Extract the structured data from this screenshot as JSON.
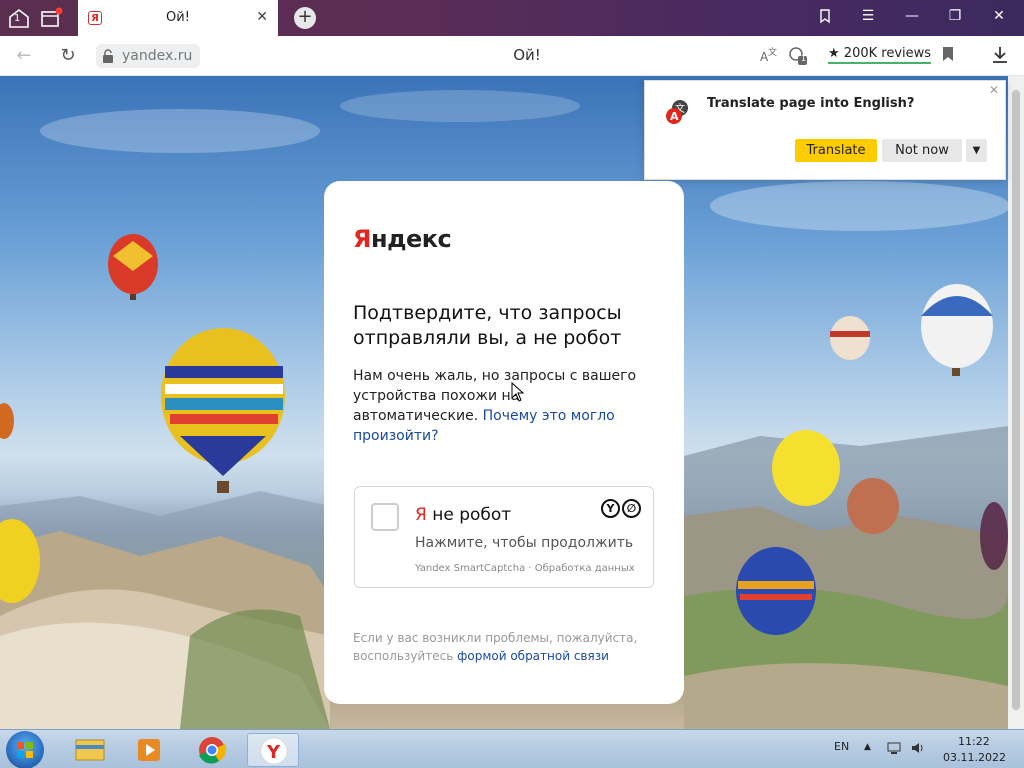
{
  "browser": {
    "tab_title": "Ой!",
    "tab_badge": "1",
    "url": "yandex.ru",
    "page_title": "Ой!",
    "reviews_label": "200K reviews",
    "extension_badge": "1"
  },
  "translate_popup": {
    "title": "Translate page into English?",
    "translate_label": "Translate",
    "not_now_label": "Not now"
  },
  "captcha": {
    "logo_first": "Я",
    "logo_rest": "ндекс",
    "heading": "Подтвердите, что запросы отправляли вы, а не робот",
    "description": "Нам очень жаль, но запросы с вашего устройства похожи на автоматические.",
    "why_link": "Почему это могло произойти?",
    "checkbox_first": "Я",
    "checkbox_rest": " не робот",
    "checkbox_sub": "Нажмите, чтобы продолжить",
    "checkbox_footer": "Yandex SmartCaptcha · Обработка данных",
    "help_text": "Если у вас возникли проблемы, пожалуйста, воспользуйтесь",
    "help_link": "формой обратной связи"
  },
  "taskbar": {
    "lang": "EN",
    "time": "11:22",
    "date": "03.11.2022"
  },
  "colors": {
    "yandex_red": "#e0261f",
    "translate_yellow": "#ffcc00",
    "link_blue": "#1a4aa0"
  }
}
